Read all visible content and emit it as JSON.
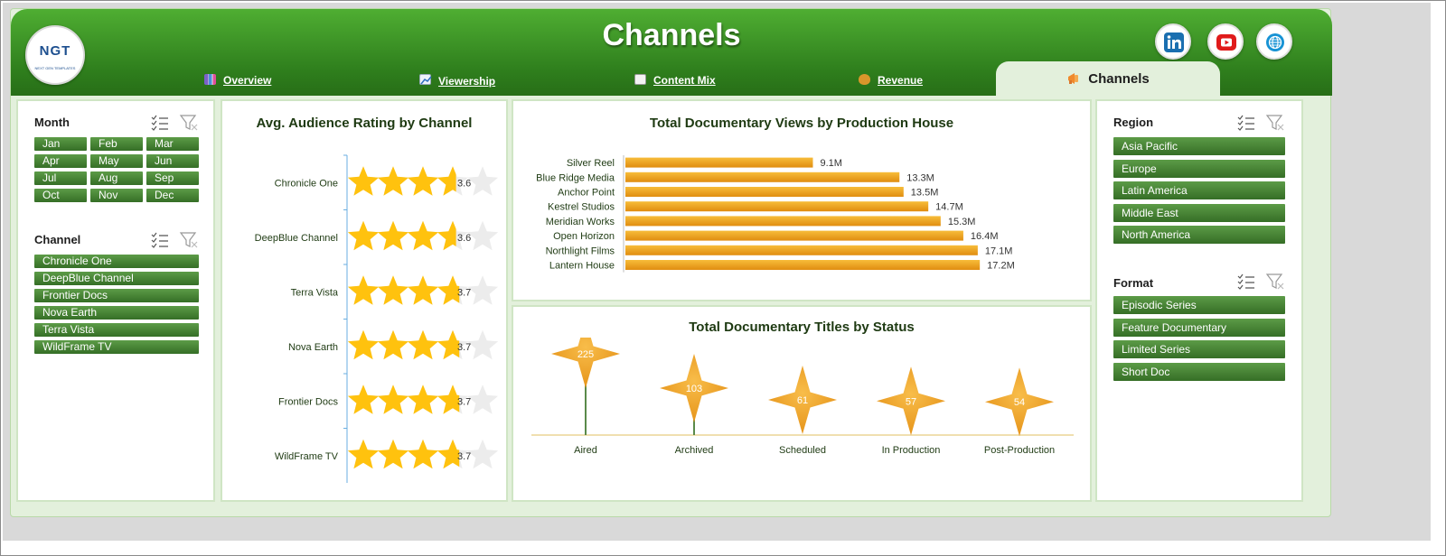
{
  "header": {
    "title": "Channels",
    "logo_text": "NGT",
    "logo_subtext": "NEXT GEN TEMPLATES"
  },
  "tabs": [
    {
      "label": "Overview",
      "icon": "bar-chart-icon",
      "active": false
    },
    {
      "label": "Viewership",
      "icon": "line-chart-icon",
      "active": false
    },
    {
      "label": "Content Mix",
      "icon": "clipboard-icon",
      "active": false
    },
    {
      "label": "Revenue",
      "icon": "money-bag-icon",
      "active": false
    },
    {
      "label": "Channels",
      "icon": "megaphone-icon",
      "active": true
    }
  ],
  "social": [
    "linkedin-icon",
    "youtube-icon",
    "web-globe-icon"
  ],
  "slicers": {
    "month": {
      "label": "Month",
      "items": [
        "Jan",
        "Feb",
        "Mar",
        "Apr",
        "May",
        "Jun",
        "Jul",
        "Aug",
        "Sep",
        "Oct",
        "Nov",
        "Dec"
      ]
    },
    "channel": {
      "label": "Channel",
      "items": [
        "Chronicle One",
        "DeepBlue Channel",
        "Frontier Docs",
        "Nova Earth",
        "Terra Vista",
        "WildFrame TV"
      ]
    },
    "region": {
      "label": "Region",
      "items": [
        "Asia Pacific",
        "Europe",
        "Latin America",
        "Middle East",
        "North America"
      ]
    },
    "format": {
      "label": "Format",
      "items": [
        "Episodic Series",
        "Feature Documentary",
        "Limited Series",
        "Short Doc"
      ]
    }
  },
  "colors": {
    "header_green": "#3f9a28",
    "slicer_green": "#4a8837",
    "star_gold": "#ffc20e",
    "bar_orange": "#f0a01a",
    "star_shape": "#f0a020"
  },
  "chart_data": [
    {
      "type": "bar",
      "title": "Avg. Audience Rating by Channel",
      "categories": [
        "Chronicle One",
        "DeepBlue Channel",
        "Terra Vista",
        "Nova Earth",
        "Frontier Docs",
        "WildFrame TV"
      ],
      "values": [
        3.6,
        3.6,
        3.7,
        3.7,
        3.7,
        3.7
      ],
      "max_rating": 5,
      "orientation": "horizontal",
      "mark": "star-rating"
    },
    {
      "type": "bar",
      "title": "Total Documentary Views by Production House",
      "categories": [
        "Silver Reel",
        "Blue Ridge Media",
        "Anchor Point",
        "Kestrel Studios",
        "Meridian Works",
        "Open Horizon",
        "Northlight Films",
        "Lantern House"
      ],
      "values": [
        9.1,
        13.3,
        13.5,
        14.7,
        15.3,
        16.4,
        17.1,
        17.2
      ],
      "labels": [
        "9.1M",
        "13.3M",
        "13.5M",
        "14.7M",
        "15.3M",
        "16.4M",
        "17.1M",
        "17.2M"
      ],
      "orientation": "horizontal",
      "unit": "M"
    },
    {
      "type": "scatter",
      "title": "Total Documentary Titles by Status",
      "categories": [
        "Aired",
        "Archived",
        "Scheduled",
        "In Production",
        "Post-Production"
      ],
      "values": [
        225,
        103,
        61,
        57,
        54
      ],
      "mark": "four-point-star"
    }
  ]
}
